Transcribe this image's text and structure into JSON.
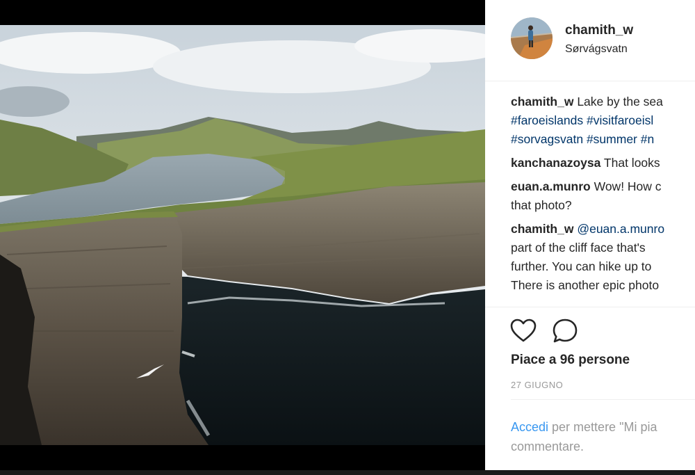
{
  "post": {
    "username": "chamith_w",
    "location": "Sørvágsvatn",
    "caption": {
      "text": "Lake by the sea",
      "tags_line1": "#faroeislands #visitfaroeisl",
      "tags_line2": "#sorvagsvatn #summer #n"
    },
    "comments": [
      {
        "user": "kanchanazoysa",
        "lines": [
          "That looks"
        ]
      },
      {
        "user": "euan.a.munro",
        "lines": [
          "Wow! How c",
          "that photo?"
        ]
      },
      {
        "user": "chamith_w",
        "mention": "@euan.a.munro",
        "lines": [
          "part of the cliff face that's",
          "further. You can hike up to",
          "There is another epic photo"
        ]
      }
    ],
    "actions": {
      "like_icon": "heart-icon",
      "comment_icon": "comment-icon"
    },
    "likes": "Piace a 96 persone",
    "date": "27 GIUGNO",
    "login_prompt": {
      "link": "Accedi",
      "rest_line1": " per mettere \"Mi pia",
      "rest_line2": "commentare."
    }
  },
  "colors": {
    "text": "#262626",
    "hashtag": "#003569",
    "link": "#3897f0",
    "muted": "#999999"
  }
}
